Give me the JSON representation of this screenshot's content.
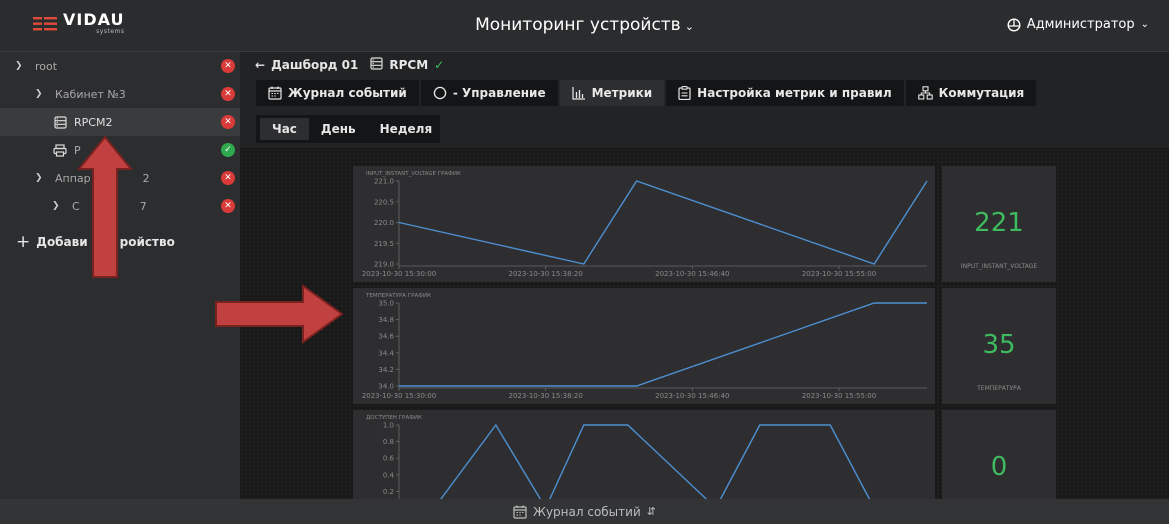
{
  "header": {
    "logo_text": "VIDAU",
    "logo_sub": "systems",
    "title": "Мониторинг устройств",
    "user": "Администратор"
  },
  "sidebar": {
    "items": [
      {
        "label": "root",
        "status": "error"
      },
      {
        "label": "Кабинет №3",
        "status": "error"
      },
      {
        "label": "RPCM2",
        "status": "error"
      },
      {
        "label": "P",
        "status": "ok"
      },
      {
        "label": "Аппар",
        "label_tail": "2",
        "status": "error"
      },
      {
        "label": "С",
        "label_tail": "7",
        "status": "error"
      }
    ],
    "add_device": {
      "label_start": "Добави",
      "label_end": "ройство"
    }
  },
  "breadcrumb": {
    "back": "Дашборд 01",
    "device": "RPCM"
  },
  "tabs": [
    {
      "label": "Журнал событий",
      "icon": "calendar-icon"
    },
    {
      "label": "- Управление",
      "icon": "circle-icon"
    },
    {
      "label": "Метрики",
      "icon": "bar-chart-icon",
      "active": true
    },
    {
      "label": "Настройка метрик и правил",
      "icon": "clipboard-icon"
    },
    {
      "label": "Коммутация",
      "icon": "network-icon"
    }
  ],
  "periods": [
    {
      "label": "Час",
      "active": true
    },
    {
      "label": "День"
    },
    {
      "label": "Неделя"
    }
  ],
  "panels": [
    {
      "title": "INPUT_INSTANT_VOLTAGE ГРАФИК",
      "value": "221",
      "value_caption": "INPUT_INSTANT_VOLTAGE"
    },
    {
      "title": "ТЕМПЕРАТУРА ГРАФИК",
      "value": "35",
      "value_caption": "ТЕМПЕРАТУРА"
    },
    {
      "title": "ДОСТУПЕН ГРАФИК",
      "value": "0",
      "value_caption": ""
    }
  ],
  "chart_data": [
    {
      "type": "line",
      "title": "INPUT_INSTANT_VOLTAGE ГРАФИК",
      "x_ticks": [
        "2023-10-30 15:30:00",
        "2023-10-30 15:38:20",
        "2023-10-30 15:46:40",
        "2023-10-30 15:55:00"
      ],
      "y_ticks": [
        "219.0",
        "219.5",
        "220.0",
        "220.5",
        "221.0"
      ],
      "ylim": [
        219.0,
        221.0
      ],
      "xlim": [
        "2023-10-30 15:30:00",
        "2023-10-30 16:00:00"
      ],
      "x": [
        "2023-10-30 15:30:00",
        "2023-10-30 15:40:30",
        "2023-10-30 15:43:30",
        "2023-10-30 15:57:00",
        "2023-10-30 16:00:00"
      ],
      "y": [
        220.0,
        219.0,
        221.0,
        219.0,
        221.0
      ],
      "color": "#4d8fd1"
    },
    {
      "type": "line",
      "title": "ТЕМПЕРАТУРА ГРАФИК",
      "x_ticks": [
        "2023-10-30 15:30:00",
        "2023-10-30 15:38:20",
        "2023-10-30 15:46:40",
        "2023-10-30 15:55:00"
      ],
      "y_ticks": [
        "34.0",
        "34.2",
        "34.4",
        "34.6",
        "34.8",
        "35.0"
      ],
      "ylim": [
        34.0,
        35.0
      ],
      "xlim": [
        "2023-10-30 15:30:00",
        "2023-10-30 16:00:00"
      ],
      "x": [
        "2023-10-30 15:30:00",
        "2023-10-30 15:43:30",
        "2023-10-30 15:57:00",
        "2023-10-30 16:00:00"
      ],
      "y": [
        34.0,
        34.0,
        35.0,
        35.0
      ],
      "color": "#4d8fd1"
    },
    {
      "type": "line",
      "title": "ДОСТУПЕН ГРАФИК",
      "y_ticks": [
        "0.2",
        "0.4",
        "0.6",
        "0.8",
        "1.0"
      ],
      "ylim": [
        0,
        1.0
      ],
      "xlim": [
        "2023-10-30 15:30:00",
        "2023-10-30 16:00:00"
      ],
      "x": [
        "2023-10-30 15:30:00",
        "2023-10-30 15:32:00",
        "2023-10-30 15:35:30",
        "2023-10-30 15:38:20",
        "2023-10-30 15:40:30",
        "2023-10-30 15:43:00",
        "2023-10-30 15:48:00",
        "2023-10-30 15:50:30",
        "2023-10-30 15:54:30",
        "2023-10-30 15:57:00",
        "2023-10-30 16:00:00"
      ],
      "y": [
        0,
        0,
        1.0,
        0,
        1.0,
        1.0,
        0,
        1.0,
        1.0,
        0,
        0
      ],
      "color": "#4d8fd1"
    }
  ],
  "footer": {
    "label": "Журнал событий"
  },
  "colors": {
    "accent_green": "#3dbb5e",
    "error_red": "#d93a3a",
    "line_blue": "#4d8fd1",
    "arrow_red": "#c0413f"
  }
}
